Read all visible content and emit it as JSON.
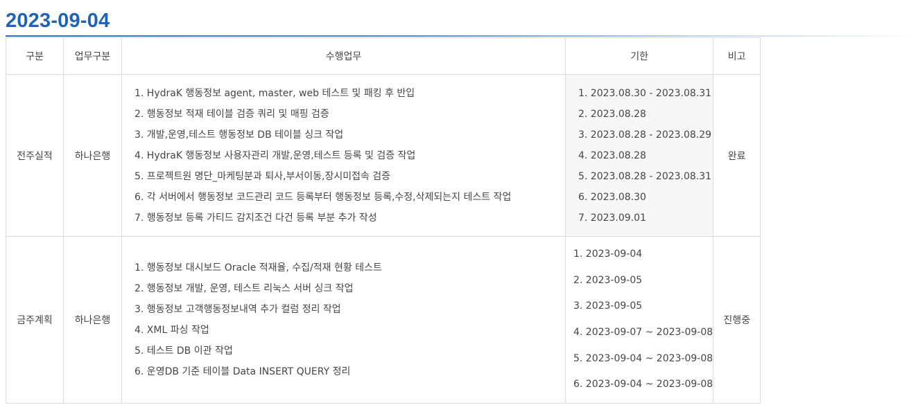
{
  "report": {
    "date": "2023-09-04"
  },
  "table": {
    "headers": [
      "구분",
      "업무구분",
      "수행업무",
      "기한",
      "비고"
    ],
    "rows": [
      {
        "category": "전주실적",
        "business": "하나은행",
        "tasks": [
          "1. HydraK 행동정보 agent, master, web 테스트 및 패킹 후 반입",
          "2. 행동정보 적재 테이블 검증 쿼리 및 매핑 검증",
          "3. 개발,운영,테스트 행동정보 DB 테이블 싱크 작업",
          "4. HydraK 행동정보 사용자관리 개발,운영,테스트 등록 및 검증 작업",
          "5. 프로젝트원 명단_마케팅분과 퇴사,부서이동,장시미접속 검증",
          "6. 각 서버에서 행동정보 코드관리 코드 등록부터 행동정보 등록,수정,삭제되는지 테스트 작업",
          "7. 행동정보 등록 가티드 감지조건 다건 등록 부분 추가 작성"
        ],
        "dates": [
          "1. 2023.08.30 - 2023.08.31",
          "2. 2023.08.28",
          "3. 2023.08.28 - 2023.08.29",
          "4. 2023.08.28",
          "5. 2023.08.28 - 2023.08.31",
          "6. 2023.08.30",
          "7. 2023.09.01"
        ],
        "note": "완료"
      },
      {
        "category": "금주계획",
        "business": "하나은행",
        "tasks": [
          "1. 행동정보 대시보드 Oracle 적재율, 수집/적재 현황 테스트",
          "2. 행동정보 개발, 운영, 테스트 리눅스 서버 싱크 작업",
          "3. 행동정보 고객행동정보내역 추가 컬럼 정리 작업",
          "4. XML 파싱 작업",
          "5. 테스트 DB 이관 작업",
          "6. 운영DB 기준 테이블 Data INSERT QUERY 정리"
        ],
        "dates": [
          "1. 2023-09-04",
          "2. 2023-09-05",
          "3. 2023-09-05",
          "4. 2023-09-07 ~ 2023-09-08",
          "5. 2023-09-04 ~ 2023-09-08",
          "6. 2023-09-04 ~ 2023-09-08"
        ],
        "note": "진행중"
      }
    ]
  }
}
